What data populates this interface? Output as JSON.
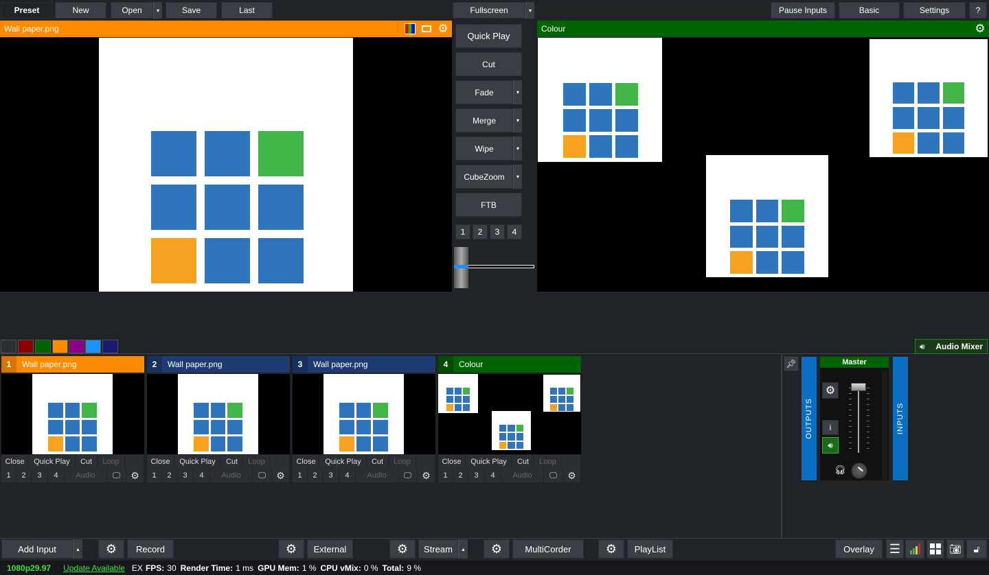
{
  "toolbar": {
    "preset": "Preset",
    "new": "New",
    "open": "Open",
    "save": "Save",
    "last": "Last",
    "fullscreen": "Fullscreen",
    "pause_inputs": "Pause Inputs",
    "basic": "Basic",
    "settings": "Settings",
    "help": "?"
  },
  "preview": {
    "title": "Wall paper.png"
  },
  "output": {
    "title": "Colour"
  },
  "transitions": {
    "quick_play": "Quick Play",
    "cut": "Cut",
    "fade": "Fade",
    "merge": "Merge",
    "wipe": "Wipe",
    "cubezoom": "CubeZoom",
    "ftb": "FTB",
    "nums": [
      "1",
      "2",
      "3",
      "4"
    ]
  },
  "audio_mixer": {
    "label": "Audio Mixer",
    "master": "Master",
    "outputs": "OUTPUTS",
    "inputs": "INPUTS",
    "info": "i"
  },
  "inputs": [
    {
      "num": "1",
      "title": "Wall paper.png",
      "color": "#ff8c00"
    },
    {
      "num": "2",
      "title": "Wall paper.png",
      "color": "#1f3b73"
    },
    {
      "num": "3",
      "title": "Wall paper.png",
      "color": "#1f3b73"
    },
    {
      "num": "4",
      "title": "Colour",
      "color": "#006400"
    }
  ],
  "input_controls": {
    "close": "Close",
    "quick_play": "Quick Play",
    "cut": "Cut",
    "loop": "Loop",
    "audio": "Audio",
    "nums": [
      "1",
      "2",
      "3",
      "4"
    ]
  },
  "bottom": {
    "add_input": "Add Input",
    "record": "Record",
    "external": "External",
    "stream": "Stream",
    "multicorder": "MultiCorder",
    "playlist": "PlayList",
    "overlay": "Overlay"
  },
  "status": {
    "format": "1080p29.97",
    "update": "Update Available",
    "ex": "EX",
    "fps_label": "FPS:",
    "fps": "30",
    "render_label": "Render Time:",
    "render": "1 ms",
    "gpu_label": "GPU Mem:",
    "gpu": "1 %",
    "cpu_label": "CPU vMix:",
    "cpu": "0 %",
    "total_label": "Total:",
    "total": "9 %"
  },
  "colors": {
    "orange": "#ff8c00",
    "green": "#006400",
    "navy": "#1f3b73",
    "accent_blue": "#0a6fc2"
  },
  "color_swatches": [
    "#2b2e33",
    "#8b0000",
    "#006400",
    "#ff8c00",
    "#8b008b",
    "#1e90ff",
    "#191970"
  ]
}
